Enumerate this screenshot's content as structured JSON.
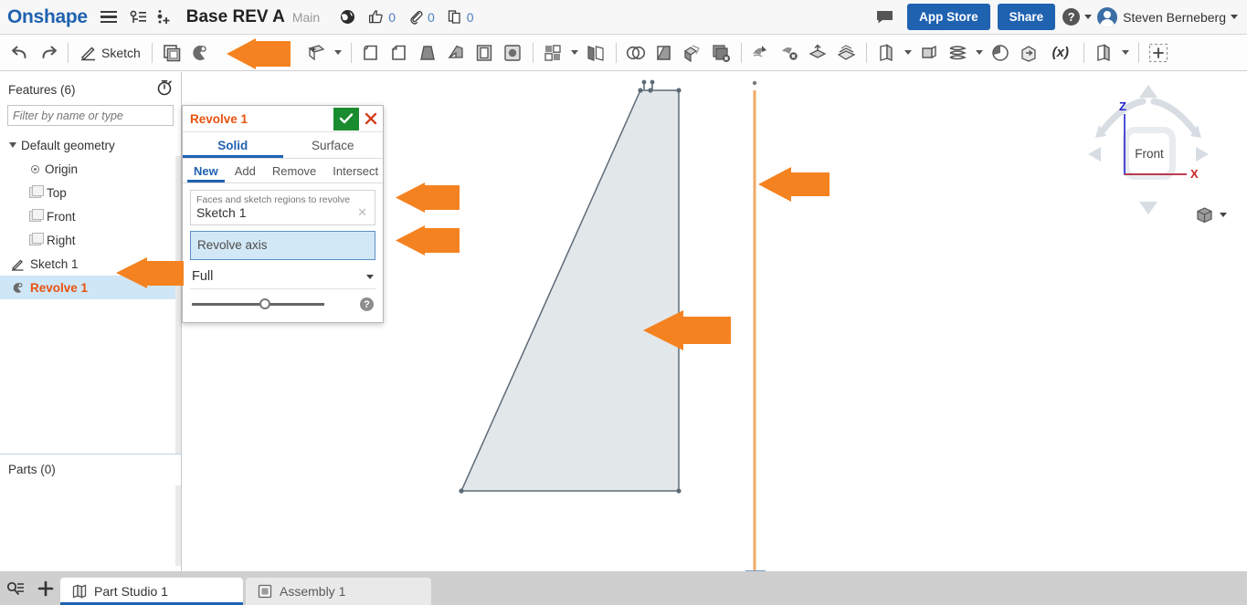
{
  "header": {
    "brand": "Onshape",
    "menu_icon": "hamburger-icon",
    "versions_icon": "version-graph-icon",
    "insert_version_icon": "insert-version-icon",
    "doc_title": "Base REV A",
    "branch": "Main",
    "public_icon": "globe-icon",
    "like_icon": "thumbs-up-icon",
    "like_count": "0",
    "link_icon": "paperclip-icon",
    "link_count": "0",
    "copy_icon": "copy-icon",
    "copy_count": "0",
    "comment_icon": "comment-icon",
    "app_store_label": "App Store",
    "share_label": "Share",
    "help_label": "?",
    "user_name": "Steven Berneberg"
  },
  "toolbar": {
    "undo_icon": "undo-icon",
    "redo_icon": "redo-icon",
    "sketch_label": "Sketch",
    "sketch_icon": "sketch-pencil-icon",
    "items": [
      {
        "name": "extrude-icon"
      },
      {
        "name": "revolve-icon"
      },
      {
        "name": "sweep-icon"
      },
      {
        "name": "loft-icon"
      },
      {
        "name": "fillet-icon"
      },
      {
        "name": "chamfer-icon"
      },
      {
        "name": "draft-icon"
      },
      {
        "name": "rib-icon"
      },
      {
        "name": "shell-icon"
      },
      {
        "name": "hole-icon"
      },
      {
        "name": "pattern-icon"
      },
      {
        "name": "mirror-icon"
      },
      {
        "name": "boolean-icon"
      },
      {
        "name": "split-icon"
      },
      {
        "name": "transform-icon"
      },
      {
        "name": "delete-face-icon"
      },
      {
        "name": "move-face-icon"
      },
      {
        "name": "replace-face-icon"
      },
      {
        "name": "thicken-icon"
      },
      {
        "name": "enclose-icon"
      },
      {
        "name": "plane-icon"
      },
      {
        "name": "sketch-plane-icon"
      },
      {
        "name": "curve-icon"
      },
      {
        "name": "measure-icon"
      },
      {
        "name": "import-icon"
      },
      {
        "name": "variable-icon"
      },
      {
        "name": "part-studio-icon"
      },
      {
        "name": "add-custom-feature-icon"
      }
    ]
  },
  "features_panel": {
    "title": "Features (6)",
    "history_icon": "stopwatch-icon",
    "filter_placeholder": "Filter by name or type",
    "filter_value": "",
    "tree": [
      {
        "label": "Default geometry",
        "icon": "chevron-down-icon",
        "level": 0,
        "selected": false
      },
      {
        "label": "Origin",
        "icon": "origin-icon",
        "level": 1,
        "selected": false
      },
      {
        "label": "Top",
        "icon": "plane-icon",
        "level": 1,
        "selected": false
      },
      {
        "label": "Front",
        "icon": "plane-icon",
        "level": 1,
        "selected": false
      },
      {
        "label": "Right",
        "icon": "plane-icon",
        "level": 1,
        "selected": false
      },
      {
        "label": "Sketch 1",
        "icon": "sketch-icon",
        "level": 0,
        "selected": false
      },
      {
        "label": "Revolve 1",
        "icon": "revolve-icon",
        "level": 0,
        "selected": true
      }
    ],
    "parts_title": "Parts (0)"
  },
  "dialog": {
    "title": "Revolve 1",
    "accept_icon": "checkmark-icon",
    "cancel_icon": "close-icon",
    "main_tabs": [
      {
        "label": "Solid",
        "active": true
      },
      {
        "label": "Surface",
        "active": false
      }
    ],
    "sub_tabs": [
      {
        "label": "New",
        "active": true
      },
      {
        "label": "Add",
        "active": false
      },
      {
        "label": "Remove",
        "active": false
      },
      {
        "label": "Intersect",
        "active": false
      }
    ],
    "faces_field_label": "Faces and sketch regions to revolve",
    "faces_field_value": "Sketch 1",
    "faces_clear_icon": "close-x-icon",
    "axis_field_placeholder": "Revolve axis",
    "axis_field_value": "",
    "revolve_type": "Full",
    "revolve_type_caret": "chevron-down-icon",
    "help_icon": "help-icon",
    "opacity_slider_value": "50"
  },
  "viewport": {
    "axis_color": "#eeaa66",
    "sketch_fill": "#e2e7ea",
    "sketch_stroke": "#5d6b77",
    "origin_marker_icon": "origin-point-icon",
    "view_cube": {
      "face_label": "Front",
      "z_axis_label": "Z",
      "x_axis_label": "X",
      "z_axis_color": "#2222cc",
      "x_axis_color": "#cc2222",
      "view_menu_icon": "view-cube-icon",
      "view_menu_caret": "chevron-down-icon"
    }
  },
  "annotations": {
    "arrow_color": "#f58220",
    "arrows": [
      {
        "name": "arrow-toolbar-revolve",
        "points_to": "revolve-toolbar-button"
      },
      {
        "name": "arrow-faces-field",
        "points_to": "faces-field"
      },
      {
        "name": "arrow-axis-field",
        "points_to": "revolve-axis-field"
      },
      {
        "name": "arrow-tree-revolve",
        "points_to": "tree-item-revolve-1"
      },
      {
        "name": "arrow-viewport-axis",
        "points_to": "revolve-axis-line"
      },
      {
        "name": "arrow-viewport-sketch",
        "points_to": "sketch-region"
      }
    ]
  },
  "bottom_bar": {
    "search_icon": "search-tabs-icon",
    "add_icon": "plus-icon",
    "tabs": [
      {
        "label": "Part Studio 1",
        "icon": "part-studio-icon",
        "active": true
      },
      {
        "label": "Assembly 1",
        "icon": "assembly-icon",
        "active": false
      }
    ]
  }
}
